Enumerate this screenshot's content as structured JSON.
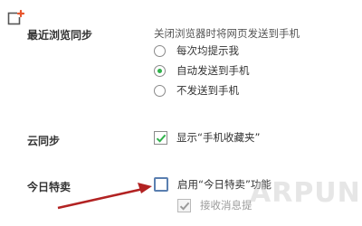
{
  "sync_recent": {
    "title": "最近浏览同步",
    "description": "关闭浏览器时将网页发送到手机",
    "options": [
      {
        "label": "每次均提示我",
        "checked": false
      },
      {
        "label": "自动发送到手机",
        "checked": true
      },
      {
        "label": "不发送到手机",
        "checked": false
      }
    ]
  },
  "cloud_sync": {
    "title": "云同步",
    "checkbox_label": "显示“手机收藏夹”",
    "checked": true
  },
  "today_deals": {
    "title": "今日特卖",
    "checkbox_label": "启用“今日特卖”功能",
    "checked": false,
    "sub_checkbox_label": "接收消息提",
    "sub_checked": true
  },
  "watermark": "ARPUN",
  "colors": {
    "radio_selected": "#2fb24a",
    "checkmark": "#2fb24a",
    "add_icon": "#e8552c",
    "arrow": "#b22222"
  }
}
